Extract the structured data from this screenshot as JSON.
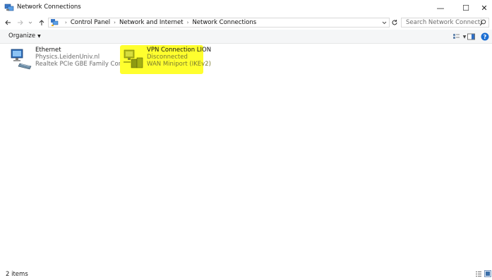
{
  "window": {
    "title": "Network Connections",
    "icon": "network-connections-icon",
    "buttons": {
      "minimize": "—",
      "maximize": "☐",
      "close": "✕"
    }
  },
  "addressbar": {
    "icons": {
      "back": "back-arrow-icon",
      "forward": "forward-arrow-icon",
      "recent": "recent-locations-icon",
      "up": "up-arrow-icon"
    },
    "breadcrumbs": [
      "Control Panel",
      "Network and Internet",
      "Network Connections"
    ],
    "search_placeholder": "Search Network Connections"
  },
  "commandbar": {
    "organize_label": "Organize"
  },
  "items": [
    {
      "name": "Ethernet",
      "network": "Physics.LeidenUniv.nl",
      "device": "Realtek PCIe GBE Family Controller",
      "icon": "ethernet-adapter-icon"
    },
    {
      "name": "VPN Connection LION",
      "network": "Disconnected",
      "device": "WAN Miniport (IKEv2)",
      "icon": "vpn-adapter-icon",
      "highlight_color": "#ffff2e"
    }
  ],
  "statusbar": {
    "count_text": "2 items"
  },
  "colors": {
    "accent": "#0078d7",
    "highlight": "#ffff2e"
  }
}
